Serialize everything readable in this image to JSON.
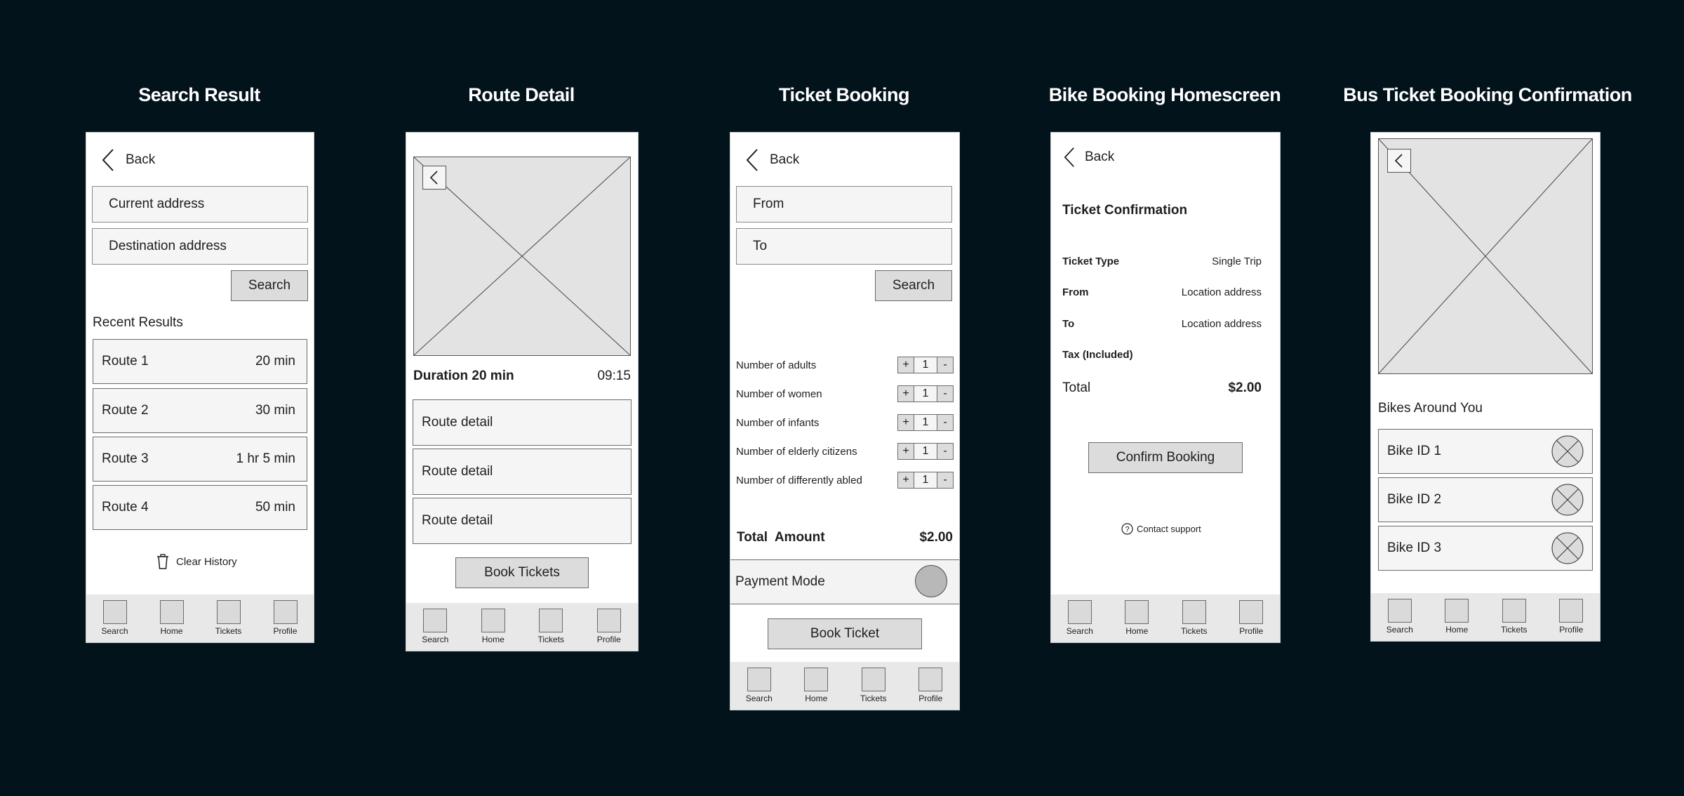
{
  "titles": [
    "Search Result",
    "Route Detail",
    "Ticket Booking",
    "Bike Booking Homescreen",
    "Bus Ticket Booking Confirmation"
  ],
  "nav": [
    "Search",
    "Home",
    "Tickets",
    "Profile"
  ],
  "search_result": {
    "back": "Back",
    "current_address": "Current address",
    "destination_address": "Destination address",
    "search": "Search",
    "recent_results": "Recent Results",
    "routes": [
      {
        "name": "Route 1",
        "time": "20 min"
      },
      {
        "name": "Route 2",
        "time": "30 min"
      },
      {
        "name": "Route 3",
        "time": "1 hr 5 min"
      },
      {
        "name": "Route 4",
        "time": "50 min"
      }
    ],
    "clear_history": "Clear History"
  },
  "route_detail": {
    "duration": "Duration 20 min",
    "time": "09:15",
    "details": [
      "Route detail",
      "Route detail",
      "Route detail"
    ],
    "book_tickets": "Book Tickets"
  },
  "ticket_booking": {
    "back": "Back",
    "from": "From",
    "to": "To",
    "search": "Search",
    "counters": [
      {
        "label": "Number of adults",
        "value": "1"
      },
      {
        "label": "Number of women",
        "value": "1"
      },
      {
        "label": "Number of infants",
        "value": "1"
      },
      {
        "label": "Number of elderly citizens",
        "value": "1"
      },
      {
        "label": "Number of differently abled",
        "value": "1"
      }
    ],
    "plus": "+",
    "minus": "-",
    "total_label": "Total  Amount",
    "total_value": "$2.00",
    "payment_mode": "Payment Mode",
    "book_ticket": "Book Ticket"
  },
  "confirmation": {
    "back": "Back",
    "heading": "Ticket Confirmation",
    "rows": [
      {
        "label": "Ticket Type",
        "value": "Single Trip"
      },
      {
        "label": "From",
        "value": "Location address"
      },
      {
        "label": "To",
        "value": "Location address"
      },
      {
        "label": "Tax (Included)",
        "value": ""
      }
    ],
    "total_label": "Total",
    "total_value": "$2.00",
    "confirm": "Confirm Booking",
    "support": "Contact support"
  },
  "bikes": {
    "heading": "Bikes Around You",
    "items": [
      "Bike ID 1",
      "Bike ID 2",
      "Bike ID 3"
    ]
  }
}
